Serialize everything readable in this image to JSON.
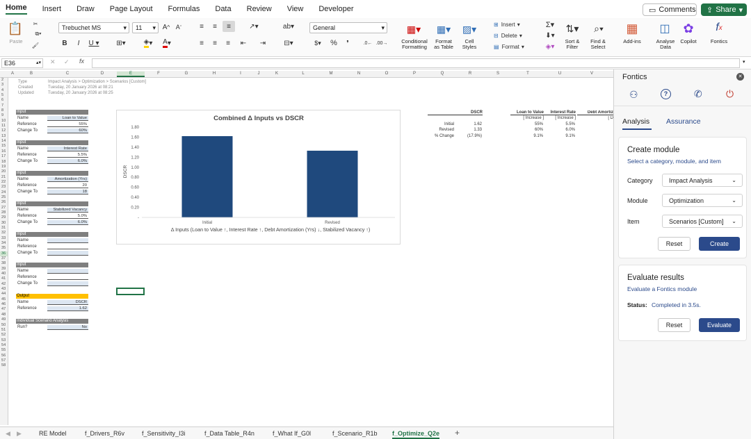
{
  "menu": {
    "tabs": [
      "Home",
      "Insert",
      "Draw",
      "Page Layout",
      "Formulas",
      "Data",
      "Review",
      "View",
      "Developer"
    ],
    "comments": "Comments",
    "share": "Share"
  },
  "ribbon": {
    "paste": "Paste",
    "font_name": "Trebuchet MS",
    "font_size": "11",
    "number_format": "General",
    "insert": "Insert",
    "delete": "Delete",
    "format": "Format",
    "conditional_formatting": "Conditional\nFormatting",
    "format_as_table": "Format\nas Table",
    "cell_styles": "Cell\nStyles",
    "sort_filter": "Sort &\nFilter",
    "find_select": "Find &\nSelect",
    "addins": "Add-ins",
    "analyse_data": "Analyse\nData",
    "copilot": "Copilot",
    "fontics": "Fontics"
  },
  "formula": {
    "cell_ref": "E36",
    "fx": "fx",
    "value": ""
  },
  "columns": [
    "A",
    "B",
    "C",
    "D",
    "E",
    "F",
    "G",
    "H",
    "I",
    "J",
    "K",
    "L",
    "M",
    "N",
    "O",
    "P",
    "Q",
    "R",
    "S",
    "T",
    "U",
    "V"
  ],
  "meta": {
    "type_label": "Type",
    "type_value": "Impact Analysis > Optimization > Scenarios [Custom]",
    "created_label": "Created",
    "created_value": "Tuesday, 20 January 2026 at 08:21",
    "updated_label": "Updated",
    "updated_value": "Tuesday, 20 January 2026 at 08:25"
  },
  "inputs": [
    {
      "header": "Input",
      "name": "Loan to Value",
      "reference": "55%",
      "change": "60%"
    },
    {
      "header": "Input",
      "name": "Interest Rate",
      "reference": "5.5%",
      "change": "6.0%"
    },
    {
      "header": "Input",
      "name": "Amortization (Yrs)",
      "reference": "20",
      "change": "18"
    },
    {
      "header": "Input",
      "name": "Stabilized Vacancy",
      "reference": "5.0%",
      "change": "6.0%"
    },
    {
      "header": "Input",
      "name": "",
      "reference": "",
      "change": ""
    },
    {
      "header": "Input",
      "name": "",
      "reference": "",
      "change": ""
    }
  ],
  "labels": {
    "name": "Name",
    "reference": "Reference",
    "change_to": "Change To",
    "run": "Run?"
  },
  "output": {
    "header": "Output",
    "name": "DSCR",
    "reference": "1.62"
  },
  "scenario": {
    "header": "Individual Scenario Analysis",
    "run_value": "No"
  },
  "summary": {
    "headers": [
      "DSCR",
      "Loan to Value",
      "Interest Rate",
      "Debt Amortiz"
    ],
    "sub": [
      "[ Increase ]",
      "[ Increase ]",
      "[ D"
    ],
    "rows": [
      {
        "label": "Initial",
        "dscr": "1.62",
        "ltv": "55%",
        "ir": "5.5%"
      },
      {
        "label": "Revised",
        "dscr": "1.33",
        "ltv": "60%",
        "ir": "6.0%"
      },
      {
        "label": "% Change",
        "dscr": "(17.9%)",
        "ltv": "9.1%",
        "ir": "9.1%"
      }
    ]
  },
  "chart_data": {
    "type": "bar",
    "title": "Combined Δ Inputs vs DSCR",
    "categories": [
      "Initial",
      "Revised"
    ],
    "values": [
      1.62,
      1.33
    ],
    "xlabel": "Δ Inputs (Loan to Value ↑, Interest Rate ↑, Debt Amortization (Yrs) ↓, Stabilized Vacancy ↑)",
    "ylabel": "DSCR",
    "ylim": [
      0,
      1.8
    ],
    "yticks": [
      "1.80",
      "1.60",
      "1.40",
      "1.20",
      "1.00",
      "0.80",
      "0.60",
      "0.40",
      "0.20",
      "-"
    ],
    "color": "#1f497d",
    "grid": false
  },
  "sheets": [
    "RE Model",
    "f_Drivers_R6v",
    "f_Sensitivity_I3i",
    "f_Data Table_R4n",
    "f_What If_G0l",
    "f_Scenario_R1b",
    "f_Optimize_Q2e"
  ],
  "pane": {
    "title": "Fontics",
    "tabs": [
      "Analysis",
      "Assurance"
    ],
    "create": {
      "title": "Create module",
      "subtitle": "Select a category, module, and item",
      "category_label": "Category",
      "category_value": "Impact Analysis",
      "module_label": "Module",
      "module_value": "Optimization",
      "item_label": "Item",
      "item_value": "Scenarios [Custom]",
      "reset": "Reset",
      "create": "Create"
    },
    "evaluate": {
      "title": "Evaluate results",
      "subtitle": "Evaluate a Fontics module",
      "status_label": "Status:",
      "status_value": "Completed in 3.5s.",
      "reset": "Reset",
      "evaluate": "Evaluate"
    }
  },
  "colors": {
    "accent": "#217346",
    "primary": "#2b4a8b",
    "bar": "#1f497d"
  }
}
